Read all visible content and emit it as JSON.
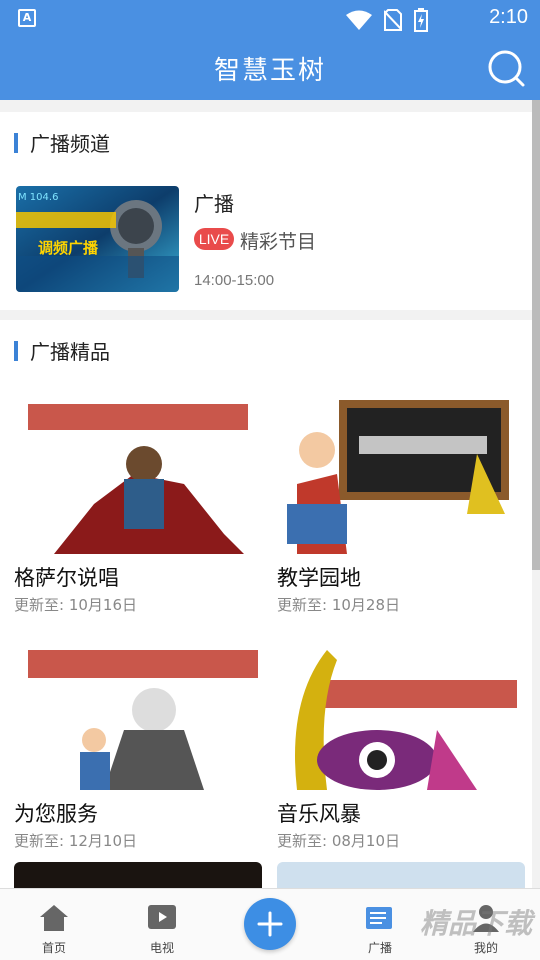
{
  "status": {
    "time": "2:10",
    "app_badge": "A"
  },
  "appbar": {
    "title": "智慧玉树"
  },
  "channels": {
    "heading": "广播频道",
    "item": {
      "title": "广播",
      "badge": "LIVE",
      "subtitle": "精彩节目",
      "time": "14:00-15:00",
      "thumb_text": "调频广播",
      "thumb_freq": "M 104.6"
    }
  },
  "featured": {
    "heading": "广播精品",
    "items": [
      {
        "name": "格萨尔说唱",
        "updated": "更新至: 10月16日"
      },
      {
        "name": "教学园地",
        "updated": "更新至: 10月28日"
      },
      {
        "name": "为您服务",
        "updated": "更新至: 12月10日"
      },
      {
        "name": "音乐风暴",
        "updated": "更新至: 08月10日"
      }
    ]
  },
  "tabs": [
    {
      "label": "首页",
      "icon": "home-icon"
    },
    {
      "label": "电视",
      "icon": "tv-icon"
    },
    {
      "label": "",
      "icon": "plus-icon"
    },
    {
      "label": "广播",
      "icon": "radio-icon"
    },
    {
      "label": "我的",
      "icon": "profile-icon"
    }
  ],
  "colors": {
    "primary": "#4a90e2",
    "live": "#e94b4b"
  },
  "watermark": "精品下载"
}
